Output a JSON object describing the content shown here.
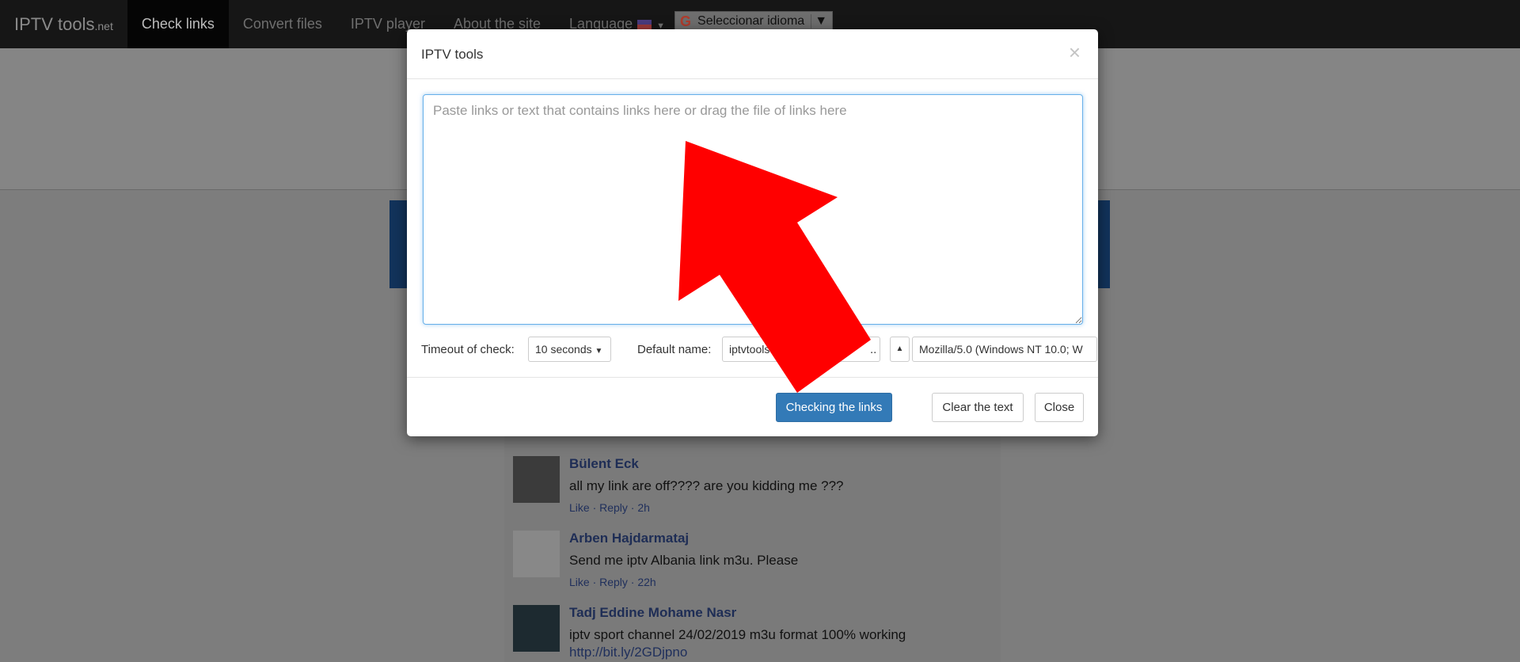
{
  "navbar": {
    "brand": "IPTV tools",
    "brand_suffix": ".net",
    "items": [
      "Check links",
      "Convert files",
      "IPTV player",
      "About the site"
    ],
    "language": "Language",
    "translate": "Seleccionar idioma"
  },
  "modal": {
    "title": "IPTV tools",
    "close_icon": "×",
    "textarea_placeholder": "Paste links or text that contains links here or drag the file of links here",
    "timeout_label": "Timeout of check:",
    "timeout_value": "10 seconds",
    "default_name_label": "Default name:",
    "default_name_value": "iptvtools",
    "ua_label_partial": "..",
    "user_agent_value": "Mozilla/5.0 (Windows NT 10.0; W",
    "check_button": "Checking the links",
    "clear_button": "Clear the text",
    "close_button": "Close"
  },
  "comments": [
    {
      "name": "Bülent Eck",
      "text": "all my link are off???? are you kidding me ???",
      "meta": "Like · Reply · 2h"
    },
    {
      "name": "Arben Hajdarmataj",
      "text": "Send me iptv Albania link m3u. Please",
      "meta": "Like · Reply · 22h"
    },
    {
      "name": "Tadj Eddine Mohame Nasr",
      "text": "iptv sport channel 24/02/2019 m3u format 100% working",
      "link": "http://bit.ly/2GDjpno"
    }
  ],
  "colors": {
    "primary": "#337ab7",
    "arrow": "#ff0000",
    "navbar": "#161616"
  }
}
